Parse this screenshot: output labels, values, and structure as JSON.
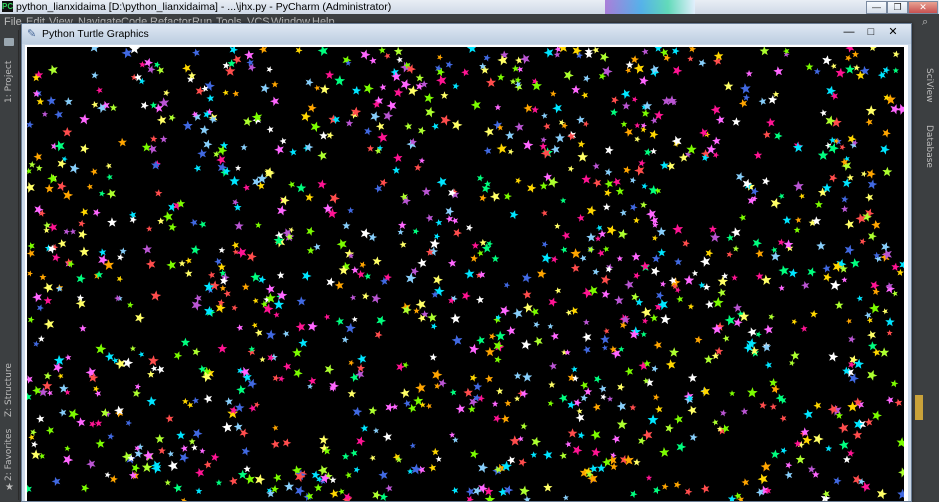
{
  "pycharm": {
    "title": "python_lianxidaima [D:\\python_lianxidaima] - ...\\jhx.py - PyCharm (Administrator)",
    "window_controls": {
      "minimize": "—",
      "maximize": "❐",
      "close": "✕"
    },
    "menu": [
      "File",
      "Edit",
      "View",
      "Navigate",
      "Code",
      "Refactor",
      "Run",
      "Tools",
      "VCS",
      "Window",
      "Help"
    ],
    "left_tabs": {
      "project": "1: Project",
      "structure": "Z: Structure",
      "favorites": "2: Favorites"
    },
    "right_tabs": {
      "sciview": "SciView",
      "database": "Database"
    }
  },
  "turtle_window": {
    "title": "Python Turtle Graphics",
    "controls": {
      "minimize": "—",
      "maximize": "□",
      "close": "✕"
    },
    "background": "#000000",
    "star_palette": [
      "#ff4d4d",
      "#ffd700",
      "#7cfc00",
      "#00e5ff",
      "#ff66ff",
      "#4169e1",
      "#ffffff",
      "#ffa500",
      "#adff2f",
      "#ba55d3",
      "#00ff7f",
      "#ff1493",
      "#87cefa",
      "#ffff66"
    ],
    "star_count": 1300,
    "star_icon": "star-shape"
  }
}
